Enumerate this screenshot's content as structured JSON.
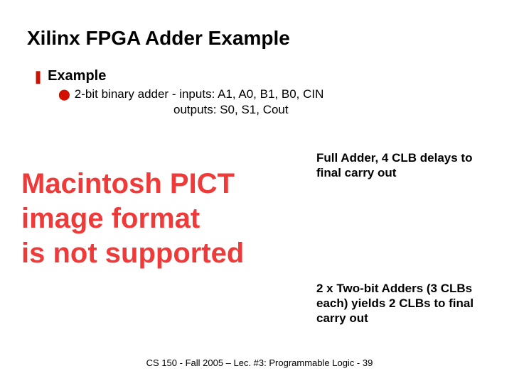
{
  "title": "Xilinx FPGA Adder Example",
  "bullets": {
    "level1": {
      "marker": "❚",
      "text": "Example"
    },
    "level2": {
      "marker": "⬤",
      "text": "2-bit binary adder - inputs: A1, A0, B1, B0, CIN",
      "outputs_line": "outputs: S0, S1, Cout"
    }
  },
  "placeholder": {
    "line1": "Macintosh PICT",
    "line2": "image format",
    "line3": "is not supported"
  },
  "notes": {
    "n1": "Full Adder, 4 CLB delays to final carry out",
    "n2": "2 x Two-bit Adders (3 CLBs each) yields 2 CLBs to final carry out"
  },
  "footer": "CS 150 - Fall 2005 – Lec. #3: Programmable Logic - 39"
}
